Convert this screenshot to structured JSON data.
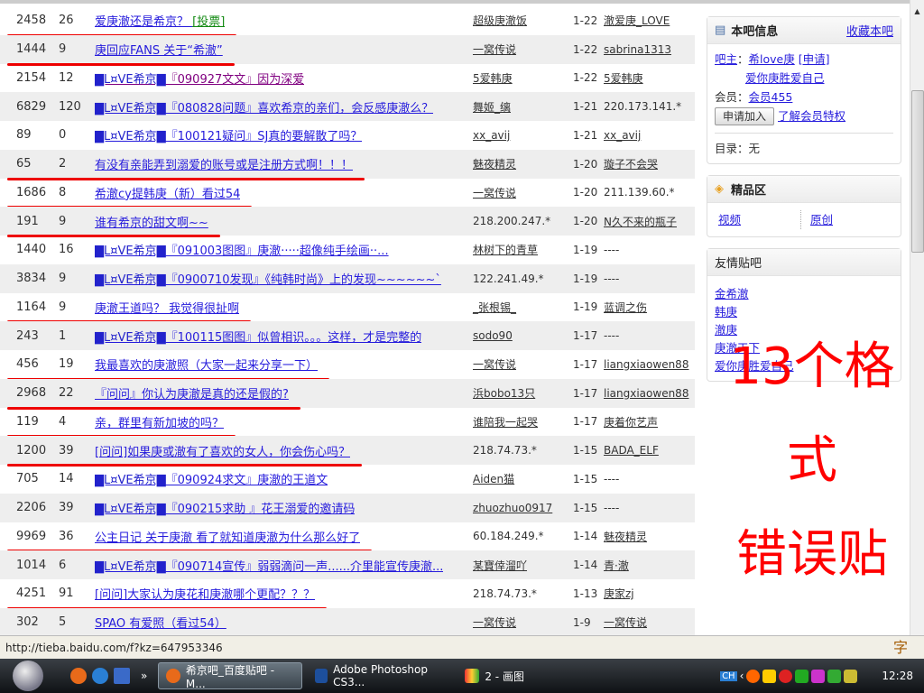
{
  "threads": [
    {
      "replies": "2458",
      "count": "26",
      "prefix": "",
      "title": "爱庚澈还是希京？",
      "tag": "[投票]",
      "author": "超级庚澈饭",
      "date": "1-22",
      "last": "澈爱庚_LOVE",
      "marked": true
    },
    {
      "replies": "1444",
      "count": "9",
      "prefix": "",
      "title": "庚回应FANS 关于“希澈”",
      "author": "一窝传说",
      "date": "1-22",
      "last": "sabrina1313",
      "marked": true
    },
    {
      "replies": "2154",
      "count": "12",
      "prefix": "▇L¤VE希京▇",
      "title": "『090927文文』因为深爱",
      "author": "5爱韩庚",
      "date": "1-22",
      "last": "5爱韩庚",
      "marked": false,
      "visited": true
    },
    {
      "replies": "6829",
      "count": "120",
      "prefix": "▇L¤VE希京▇",
      "title": "『080828问题』喜欢希京的亲们，会反感庚澈么？",
      "author": "舞姬_缡",
      "date": "1-21",
      "last": "220.173.141.*",
      "marked": false
    },
    {
      "replies": "89",
      "count": "0",
      "prefix": "▇L¤VE希京▇",
      "title": "『100121疑问』SJ真的要解散了吗？",
      "author": "xx_avij",
      "date": "1-21",
      "last": "xx_avij",
      "marked": false
    },
    {
      "replies": "65",
      "count": "2",
      "prefix": "",
      "title": "有没有亲能弄到溺爱的账号或是注册方式啊！！！",
      "author": "魅夜精灵",
      "date": "1-20",
      "last": "璇子不会哭",
      "marked": true
    },
    {
      "replies": "1686",
      "count": "8",
      "prefix": "",
      "title": "希澈cy提韩庚（新）看过54",
      "author": "一窝传说",
      "date": "1-20",
      "last": "211.139.60.*",
      "marked": true
    },
    {
      "replies": "191",
      "count": "9",
      "prefix": "",
      "title": "谁有希京的甜文啊~~",
      "author": "218.200.247.*",
      "date": "1-20",
      "last": "N久不来的瓶子",
      "marked": true
    },
    {
      "replies": "1440",
      "count": "16",
      "prefix": "▇L¤VE希京▇",
      "title": "『091003图图』庚澈·····超像纯手绘画··...",
      "author": "林树下的青草",
      "date": "1-19",
      "last": "----",
      "marked": false
    },
    {
      "replies": "3834",
      "count": "9",
      "prefix": "▇L¤VE希京▇",
      "title": "『0900710发现』《纯韩时尚》上的发现~~~~~~`",
      "author": "122.241.49.*",
      "date": "1-19",
      "last": "----",
      "marked": false
    },
    {
      "replies": "1164",
      "count": "9",
      "prefix": "",
      "title": "庚澈王道吗？ 我觉得很扯啊",
      "author": "_张根锡_",
      "date": "1-19",
      "last": "蓝调之伤",
      "marked": true
    },
    {
      "replies": "243",
      "count": "1",
      "prefix": "▇L¤VE希京▇",
      "title": "『100115图图』似曾相识。。。这样，才是完整的",
      "author": "sodo90",
      "date": "1-17",
      "last": "----",
      "marked": false
    },
    {
      "replies": "456",
      "count": "19",
      "prefix": "",
      "title": "我最喜欢的庚澈照（大家一起来分享一下）",
      "author": "一窝传说",
      "date": "1-17",
      "last": "liangxiaowen88",
      "marked": true
    },
    {
      "replies": "2968",
      "count": "22",
      "prefix": "",
      "title": "『问问』你认为庚澈是真的还是假的?",
      "author": "浜bobo13只",
      "date": "1-17",
      "last": "liangxiaowen88",
      "marked": true
    },
    {
      "replies": "119",
      "count": "4",
      "prefix": "",
      "title": "亲，群里有新加坡的吗？",
      "author": "谁陪我一起哭",
      "date": "1-17",
      "last": "庚着你艺声",
      "marked": true
    },
    {
      "replies": "1200",
      "count": "39",
      "prefix": "",
      "title": "[问问]如果庚或澈有了喜欢的女人，你会伤心吗？",
      "author": "218.74.73.*",
      "date": "1-15",
      "last": "BADA_ELF",
      "marked": true
    },
    {
      "replies": "705",
      "count": "14",
      "prefix": "▇L¤VE希京▇",
      "title": "『090924求文』庚澈的王道文",
      "author": "Aiden猫",
      "date": "1-15",
      "last": "----",
      "marked": false
    },
    {
      "replies": "2206",
      "count": "39",
      "prefix": "▇L¤VE希京▇",
      "title": "『090215求助 』花王溺爱的邀请码",
      "author": "zhuozhuo0917",
      "date": "1-15",
      "last": "----",
      "marked": false
    },
    {
      "replies": "9969",
      "count": "36",
      "prefix": "",
      "title": "公主日记 关于庚澈 看了就知道庚澈为什么那么好了",
      "author": "60.184.249.*",
      "date": "1-14",
      "last": "魅夜精灵",
      "marked": true
    },
    {
      "replies": "1014",
      "count": "6",
      "prefix": "▇L¤VE希京▇",
      "title": "『090714宣传』弱弱滴问一声......介里能宣传庚澈...",
      "author": "某寶倖溜吖",
      "date": "1-14",
      "last": "青·澈",
      "marked": false
    },
    {
      "replies": "4251",
      "count": "91",
      "prefix": "",
      "title": "[问问]大家认为庚花和庚澈哪个更配？？？",
      "author": "218.74.73.*",
      "date": "1-13",
      "last": "庚家zj",
      "marked": true
    },
    {
      "replies": "302",
      "count": "5",
      "prefix": "",
      "title": "SPAO 有爱照（看过54）",
      "author": "一窝传说",
      "date": "1-9",
      "last": "一窝传说",
      "marked": true
    }
  ],
  "sidebar": {
    "info": {
      "title": "本吧信息",
      "favorite": "收藏本吧",
      "owner_label": "吧主",
      "owners": [
        "希love庚",
        "爱你庚胜爱自己"
      ],
      "apply": "[申请]",
      "member_label": "会员",
      "members": "会员455",
      "join_button": "申请加入",
      "member_privileges": "了解会员特权",
      "catalog": "目录：无"
    },
    "featured": {
      "title": "精品区",
      "links": [
        "视频",
        "原创"
      ]
    },
    "friends": {
      "title": "友情贴吧",
      "links": [
        "金希澈",
        "韩庚",
        "澈庚",
        "庚澈天下",
        "爱你庚胜爱自己"
      ]
    }
  },
  "annotation": {
    "line1": "13个格",
    "line2": "式",
    "line3": "错误贴"
  },
  "status": {
    "url": "http://tieba.baidu.com/f?kz=647953346",
    "ime": "字"
  },
  "taskbar": {
    "chevron": "»",
    "tasks": [
      "希京吧_百度贴吧 - M...",
      "Adobe Photoshop CS3...",
      "2 - 画图"
    ],
    "lang": "CH",
    "clock": "12:28"
  }
}
